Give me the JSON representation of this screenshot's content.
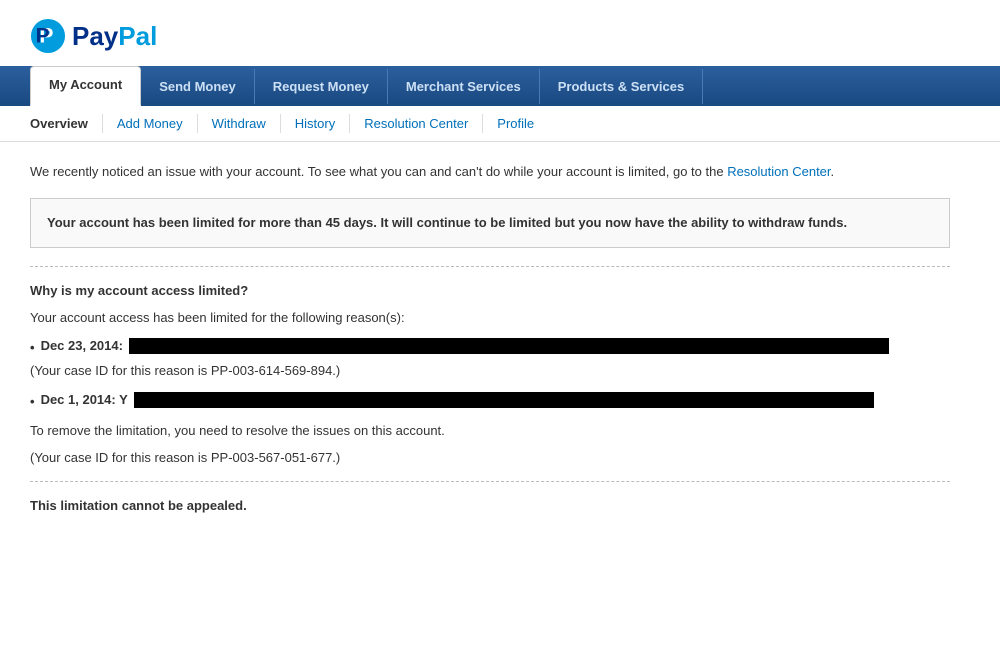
{
  "logo": {
    "pay": "Pay",
    "pal": "Pal"
  },
  "main_nav": {
    "items": [
      {
        "label": "My Account",
        "active": true
      },
      {
        "label": "Send Money",
        "active": false
      },
      {
        "label": "Request Money",
        "active": false
      },
      {
        "label": "Merchant Services",
        "active": false
      },
      {
        "label": "Products & Services",
        "active": false
      }
    ]
  },
  "sub_nav": {
    "items": [
      {
        "label": "Overview"
      },
      {
        "label": "Add Money"
      },
      {
        "label": "Withdraw"
      },
      {
        "label": "History"
      },
      {
        "label": "Resolution Center"
      },
      {
        "label": "Profile"
      }
    ]
  },
  "notice": {
    "text_before": "We recently noticed an issue with your account. To see what you can and can't do while your account is limited, go to the",
    "link": "Resolution Center",
    "text_after": "."
  },
  "warning_box": {
    "text": "Your account has been limited for more than 45 days. It will continue to be limited but you now have the ability to withdraw funds."
  },
  "section": {
    "title": "Why is my account access limited?",
    "intro": "Your account access has been limited for the following reason(s):",
    "reasons": [
      {
        "date": "Dec 23, 2014:",
        "case_id": "(Your case ID for this reason is PP-003-614-569-894.)"
      },
      {
        "date": "Dec 1, 2014: Y",
        "case_id": ""
      }
    ],
    "remove_text": "To remove the limitation, you need to resolve the issues on this account.",
    "case_id_2": "(Your case ID for this reason is PP-003-567-051-677.)",
    "footer": "This limitation cannot be appealed."
  }
}
